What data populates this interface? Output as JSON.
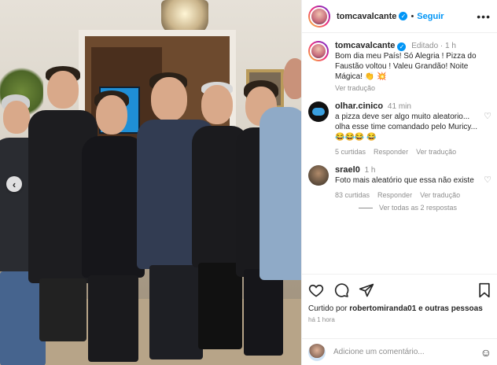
{
  "post": {
    "author": "tomcavalcante",
    "follow_label": "Seguir",
    "more_icon": "more-icon",
    "caption": {
      "author": "tomcavalcante",
      "edited_label": "Editado",
      "time": "1 h",
      "text": "Bom dia meu País! Só Alegria ! Pizza do Faustão voltou ! Valeu Grandão! Noite Mágica! 👏 💥",
      "translation_label": "Ver tradução"
    },
    "comments": [
      {
        "author": "olhar.cinico",
        "time": "41 min",
        "text": "a pizza deve ser algo muito aleatorio... olha esse time comandado pelo Muricy... 😂😂😂 😂",
        "likes": "5 curtidas",
        "reply_label": "Responder",
        "translation_label": "Ver tradução"
      },
      {
        "author": "srael0",
        "time": "1 h",
        "text": "Foto mais aleatório que essa não existe",
        "likes": "83 curtidas",
        "reply_label": "Responder",
        "translation_label": "Ver tradução",
        "view_replies": "Ver todas as 2 respostas"
      }
    ],
    "liked_by": {
      "prefix": "Curtido por",
      "user": "robertomiranda01",
      "suffix": "e outras pessoas"
    },
    "posted_time": "há 1 hora",
    "add_comment_placeholder": "Adicione um comentário...",
    "icons": [
      "heart-icon",
      "comment-icon",
      "share-icon",
      "bookmark-icon",
      "emoji-icon",
      "chevron-left-icon"
    ]
  },
  "colors": {
    "accent": "#0095f6",
    "text": "#262626",
    "muted": "#8e8e8e"
  }
}
